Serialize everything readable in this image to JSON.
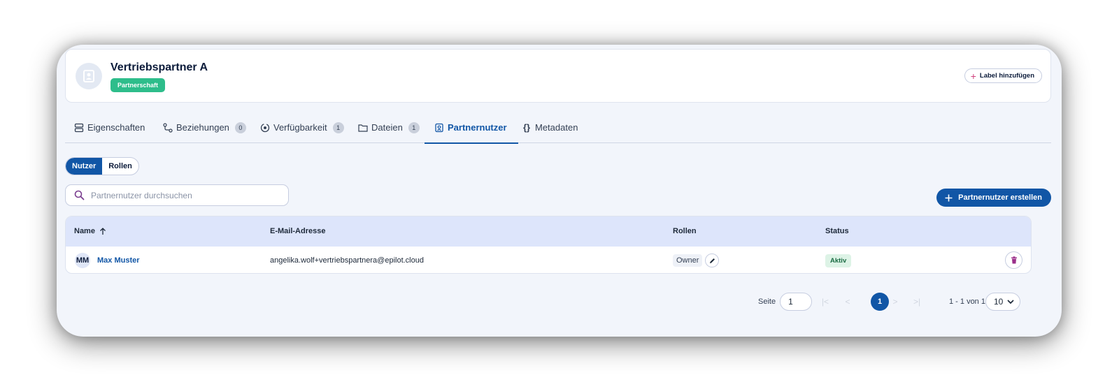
{
  "entity": {
    "title": "Vertriebspartner A",
    "badge": "Partnerschaft",
    "label_button": "Label hinzufügen"
  },
  "tabs": [
    {
      "label": "Eigenschaften",
      "icon": "rows-icon"
    },
    {
      "label": "Beziehungen",
      "icon": "relations-icon",
      "count": "0"
    },
    {
      "label": "Verfügbarkeit",
      "icon": "availability-icon",
      "count": "1"
    },
    {
      "label": "Dateien",
      "icon": "folder-icon",
      "count": "1"
    },
    {
      "label": "Partnernutzer",
      "icon": "user-badge-icon",
      "active": true
    },
    {
      "label": "Metadaten",
      "icon": "braces-icon"
    }
  ],
  "segment": {
    "users": "Nutzer",
    "roles": "Rollen",
    "selected": "Nutzer"
  },
  "search": {
    "placeholder": "Partnernutzer durchsuchen"
  },
  "create_button": "Partnernutzer erstellen",
  "table": {
    "columns": {
      "name": "Name",
      "email": "E-Mail-Adresse",
      "roles": "Rollen",
      "status": "Status"
    },
    "rows": [
      {
        "initials": "MM",
        "name": "Max Muster",
        "email": "angelika.wolf+vertriebspartnera@epilot.cloud",
        "role": "Owner",
        "status": "Aktiv"
      }
    ]
  },
  "pagination": {
    "page_label": "Seite",
    "page_value": "1",
    "current_page": "1",
    "range": "1 - 1 von 1",
    "page_size": "10"
  },
  "colors": {
    "primary": "#1156a6",
    "badge_green": "#2ebd8b",
    "accent_pink": "#d0427e"
  }
}
